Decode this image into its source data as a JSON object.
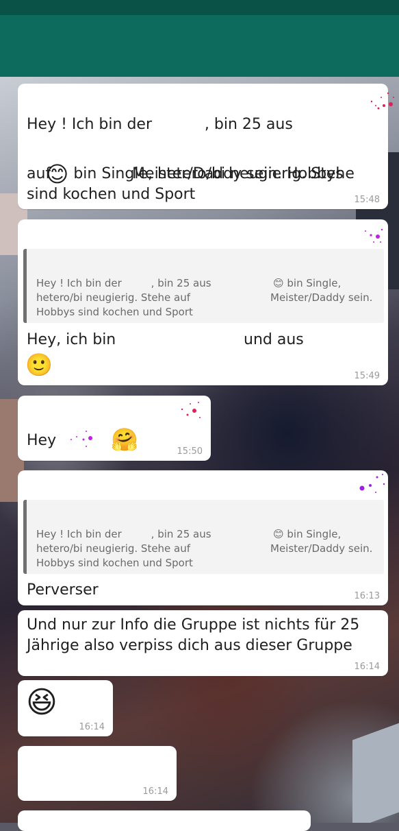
{
  "messages": [
    {
      "line1": "Hey ! Ich bin der           , bin 25 aus",
      "line2_emoji": "😊",
      "line2": " bin Single, hetero/bi neugierig. Stehe",
      "line3": "auf                 Meister/Daddy sein. Hobbys",
      "line4": "sind kochen und Sport",
      "time": "15:48"
    },
    {
      "quote": {
        "l1a": "Hey ! Ich bin der         , bin 25 aus",
        "l1b_emoji": "😊",
        "l1b": " bin Single,",
        "l2a": "hetero/bi neugierig. Stehe auf",
        "l2b": "Meister/Daddy sein.",
        "l3": "Hobbys sind kochen und Sport"
      },
      "line1a": "Hey, ich bin",
      "line1b": "und aus",
      "emoji": "🙂",
      "time": "15:49"
    },
    {
      "text": "Hey",
      "emoji": "🤗",
      "time": "15:50"
    },
    {
      "quote": {
        "l1a": "Hey ! Ich bin der         , bin 25 aus",
        "l1b_emoji": "😊",
        "l1b": " bin Single,",
        "l2a": "hetero/bi neugierig. Stehe auf",
        "l2b": "Meister/Daddy sein.",
        "l3": "Hobbys sind kochen und Sport"
      },
      "text": "Perverser",
      "time": "16:13"
    },
    {
      "line1": "Und nur zur Info die Gruppe ist nichts für 25",
      "line2": "Jährige also verpiss dich aus dieser Gruppe",
      "time": "16:14"
    },
    {
      "emoji": "😆",
      "time": "16:14"
    },
    {
      "time": "16:14"
    }
  ]
}
